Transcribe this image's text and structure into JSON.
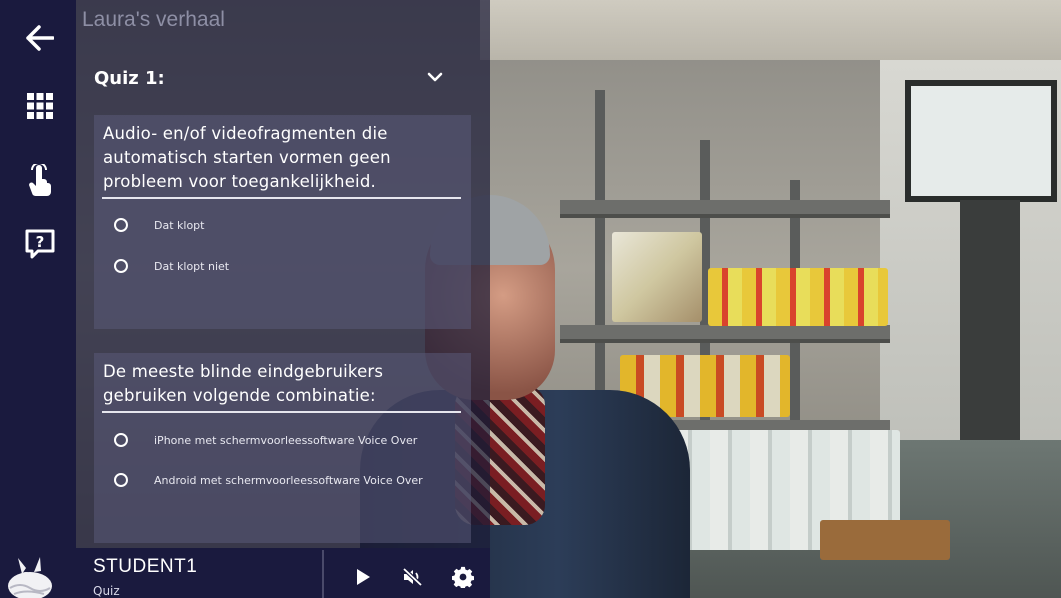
{
  "header": {
    "story_title": "Laura's verhaal"
  },
  "sidebar": {
    "items": [
      {
        "name": "back",
        "icon": "arrow-left-icon"
      },
      {
        "name": "overview",
        "icon": "grid-icon"
      },
      {
        "name": "interaction",
        "icon": "touch-hand-icon"
      },
      {
        "name": "quiz",
        "icon": "question-bubble-icon"
      }
    ]
  },
  "quiz": {
    "title": "Quiz 1:",
    "expand_icon": "chevron-down-icon",
    "questions": [
      {
        "text": "Audio- en/of videofragmenten die automatisch starten vormen geen probleem voor toegankelijkheid.",
        "options": [
          "Dat klopt",
          "Dat klopt niet"
        ]
      },
      {
        "text": "De meeste blinde eindgebruikers gebruiken volgende combinatie:",
        "options": [
          "iPhone met schermvoorleessoftware Voice Over",
          "Android met schermvoorleessoftware Voice Over"
        ]
      }
    ]
  },
  "footer": {
    "student_name": "STUDENT1",
    "mode": "Quiz",
    "controls": [
      "play-icon",
      "mute-icon",
      "gear-icon"
    ]
  },
  "colors": {
    "sidebar_bg": "#1a1a3e",
    "card_bg": "rgba(90,90,120,0.55)",
    "title_muted": "#8e8fa5"
  }
}
